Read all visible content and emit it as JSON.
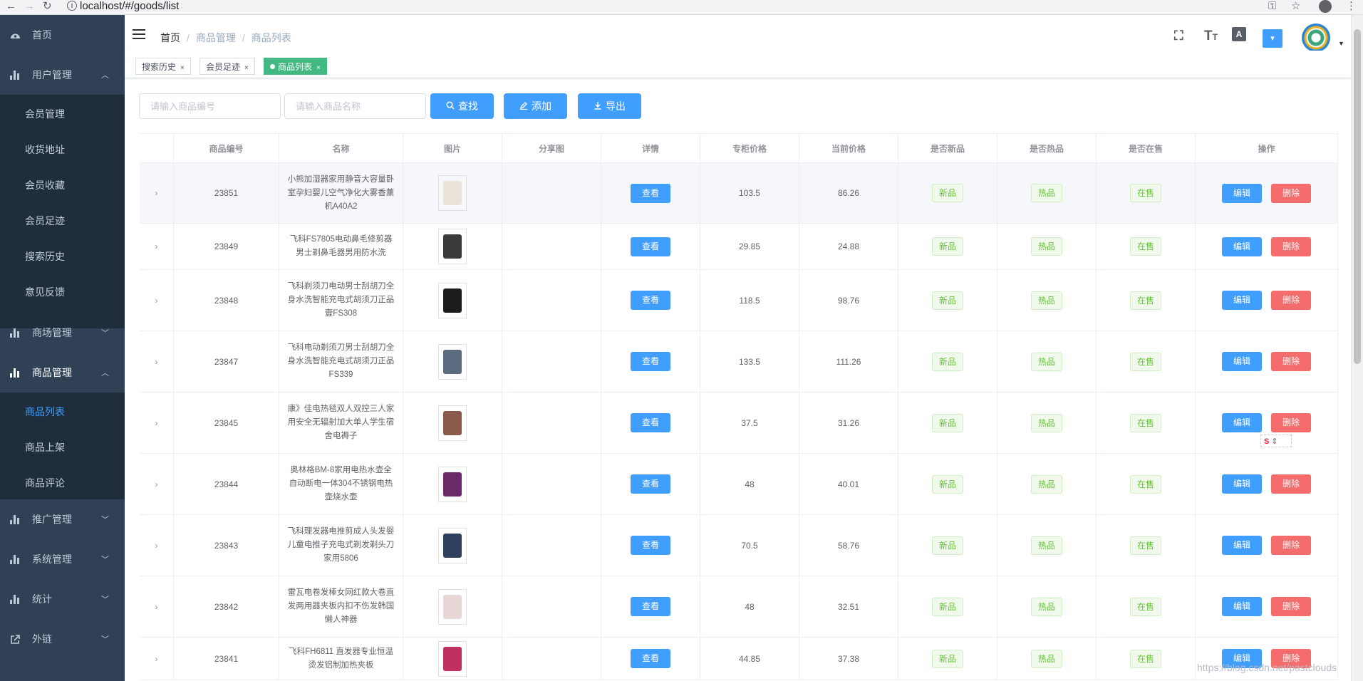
{
  "browser": {
    "url": "localhost/#/goods/list"
  },
  "sidebar": {
    "items": [
      {
        "label": "首页",
        "icon": "dashboard-icon"
      },
      {
        "label": "用户管理",
        "icon": "bar-chart-icon",
        "expanded": true,
        "children": [
          "会员管理",
          "收货地址",
          "会员收藏",
          "会员足迹",
          "搜索历史",
          "意见反馈"
        ]
      },
      {
        "label": "商场管理",
        "icon": "bar-chart-icon",
        "expanded": false
      },
      {
        "label": "商品管理",
        "icon": "bar-chart-icon",
        "expanded": true,
        "children": [
          "商品列表",
          "商品上架",
          "商品评论"
        ],
        "active_child": "商品列表"
      },
      {
        "label": "推广管理",
        "icon": "bar-chart-icon",
        "expanded": false
      },
      {
        "label": "系统管理",
        "icon": "bar-chart-icon",
        "expanded": false
      },
      {
        "label": "统计",
        "icon": "bar-chart-icon",
        "expanded": false
      },
      {
        "label": "外链",
        "icon": "external-link-icon",
        "expanded": false
      }
    ]
  },
  "navbar": {
    "breadcrumb": [
      "首页",
      "商品管理",
      "商品列表"
    ]
  },
  "tags": [
    {
      "label": "搜索历史",
      "active": false
    },
    {
      "label": "会员足迹",
      "active": false
    },
    {
      "label": "商品列表",
      "active": true
    }
  ],
  "filters": {
    "goods_sn_placeholder": "请输入商品编号",
    "name_placeholder": "请输入商品名称",
    "search_label": "查找",
    "add_label": "添加",
    "export_label": "导出"
  },
  "table": {
    "columns": [
      "商品编号",
      "名称",
      "图片",
      "分享图",
      "详情",
      "专柜价格",
      "当前价格",
      "是否新品",
      "是否热品",
      "是否在售",
      "操作"
    ],
    "detail_label": "查看",
    "new_label": "新品",
    "hot_label": "热品",
    "on_sale_label": "在售",
    "edit_label": "编辑",
    "delete_label": "删除",
    "rows": [
      {
        "sn": "23851",
        "name": "小熊加湿器家用静音大容量卧室孕妇婴儿空气净化大雾香薰机A40A2",
        "counter_price": "103.5",
        "retail_price": "86.26",
        "img_color": "#e8e2d8"
      },
      {
        "sn": "23849",
        "name": "飞科FS7805电动鼻毛修剪器男士剃鼻毛器男用防水洗",
        "counter_price": "29.85",
        "retail_price": "24.88",
        "img_color": "#3a3a3a"
      },
      {
        "sn": "23848",
        "name": "飞科剃须刀电动男士刮胡刀全身水洗智能充电式胡须刀正品壹FS308",
        "counter_price": "118.5",
        "retail_price": "98.76",
        "img_color": "#1c1c1c"
      },
      {
        "sn": "23847",
        "name": "飞科电动剃须刀男士刮胡刀全身水洗智能充电式胡须刀正品FS339",
        "counter_price": "133.5",
        "retail_price": "111.26",
        "img_color": "#5b6b80"
      },
      {
        "sn": "23845",
        "name": "康》佳电热毯双人双控三人家用安全无辐射加大单人学生宿舍电褥子",
        "counter_price": "37.5",
        "retail_price": "31.26",
        "img_color": "#8a5a4a"
      },
      {
        "sn": "23844",
        "name": "奥林格BM-8家用电热水壶全自动断电一体304不锈钢电热壶烧水壶",
        "counter_price": "48",
        "retail_price": "40.01",
        "img_color": "#6a2a6a"
      },
      {
        "sn": "23843",
        "name": "飞科理发器电推剪成人头发婴儿童电推子充电式剃发剃头刀家用5806",
        "counter_price": "70.5",
        "retail_price": "58.76",
        "img_color": "#2f3f5f"
      },
      {
        "sn": "23842",
        "name": "雷瓦电卷发棒女网红款大卷直发两用器夹板内扣不伤发韩国懒人神器",
        "counter_price": "48",
        "retail_price": "32.51",
        "img_color": "#e9d6d6"
      },
      {
        "sn": "23841",
        "name": "飞科FH6811 直发器专业恒温烫发铝制加热夹板",
        "counter_price": "44.85",
        "retail_price": "37.38",
        "img_color": "#c03060"
      }
    ]
  },
  "floating_widget": {
    "label": "S"
  },
  "watermark": "https://blog.csdn.net/pastclouds"
}
